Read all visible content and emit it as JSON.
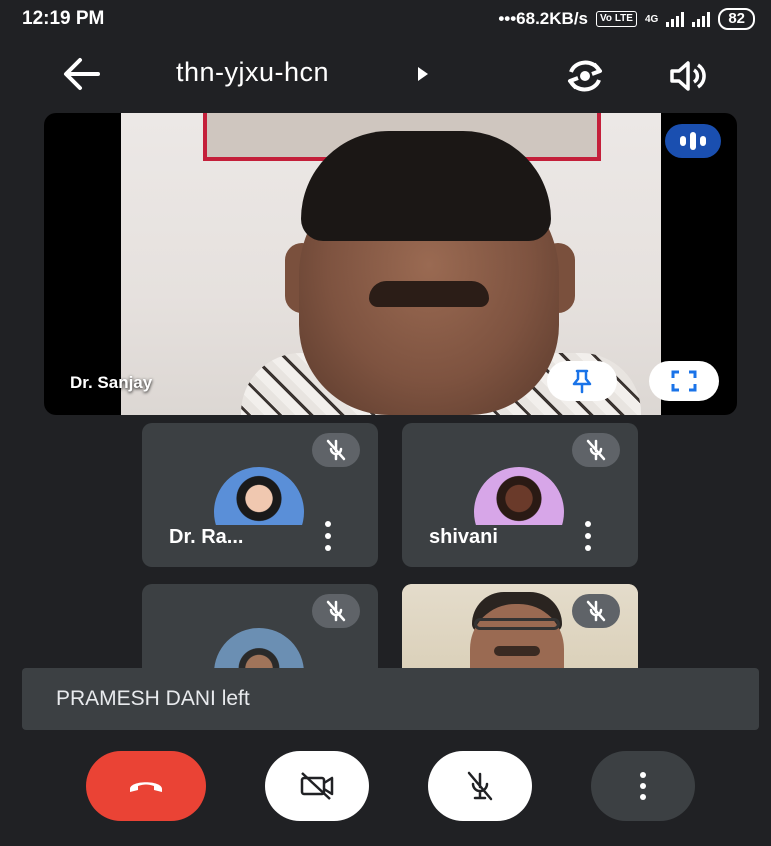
{
  "status_bar": {
    "time": "12:19 PM",
    "network_speed": "68.2KB/s",
    "volte": "Vo LTE",
    "network_type": "4G",
    "battery": "82"
  },
  "header": {
    "meeting_code": "thn-yjxu-hcn",
    "icons": [
      "back-arrow-icon",
      "switch-camera-icon",
      "speaker-icon"
    ]
  },
  "main_tile": {
    "participant_name": "Dr. Sanjay",
    "speaking_indicator": true
  },
  "participants": [
    {
      "name": "Dr. Ra...",
      "muted": true,
      "avatar_color": "#8ab4f8"
    },
    {
      "name": "shivani",
      "muted": true,
      "avatar_color": "#d7a6e8"
    },
    {
      "name": "",
      "muted": true,
      "avatar_color": "#6b8fb3"
    },
    {
      "name": "",
      "muted": true,
      "video_on": true
    }
  ],
  "toast": {
    "message": "PRAMESH DANI left"
  },
  "controls": {
    "icons": [
      "end-call-icon",
      "camera-off-icon",
      "mic-off-icon",
      "more-options-icon"
    ],
    "colors": {
      "end_call": "#ea4335",
      "background": "#202124",
      "tile": "#3c4043",
      "speaking": "#1a4fb0"
    }
  }
}
